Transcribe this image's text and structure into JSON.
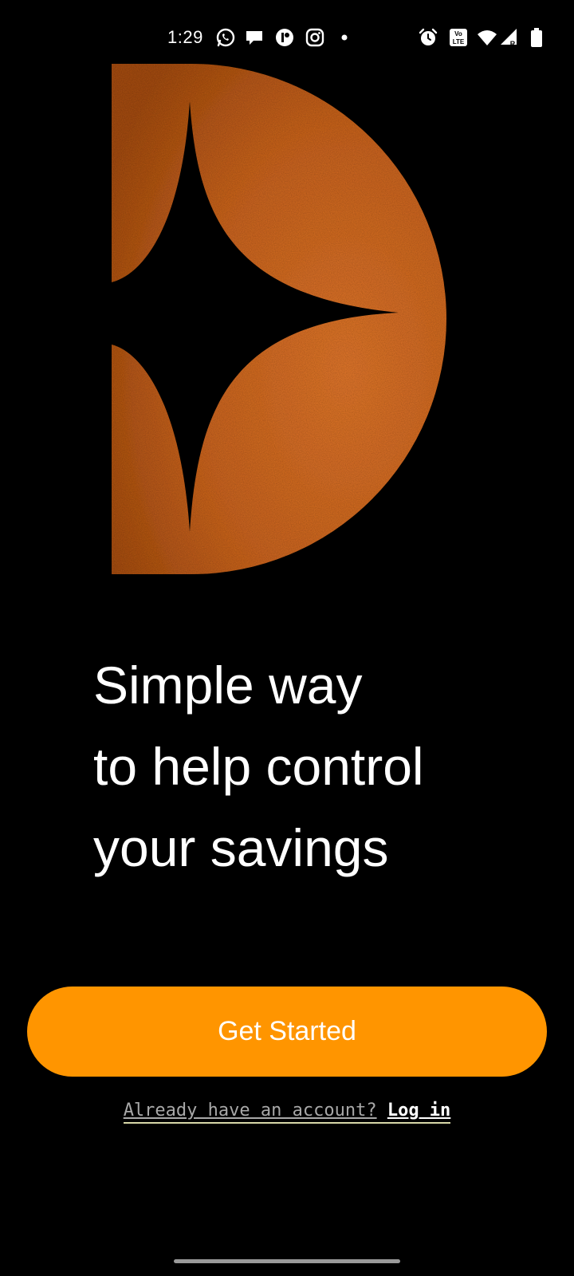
{
  "status_bar": {
    "time": "1:29",
    "left_icons": [
      "whatsapp-icon",
      "chat-bubble-icon",
      "app-icon",
      "instagram-icon",
      "dot-icon"
    ],
    "right_icons": [
      "alarm-icon",
      "volte-icon",
      "wifi-icon",
      "signal-icon",
      "battery-icon"
    ],
    "volte_label": "Vo LTE"
  },
  "hero": {
    "icon": "star-sparkle-half-circle-icon",
    "circle_color": "#C9641F",
    "star_color": "#000000"
  },
  "headline": {
    "line1": "Simple way",
    "line2": "to help control",
    "line3": "your savings"
  },
  "cta": {
    "label": "Get Started",
    "color": "#FF9500"
  },
  "login": {
    "prompt": "Already have an account?",
    "action": "Log in"
  }
}
